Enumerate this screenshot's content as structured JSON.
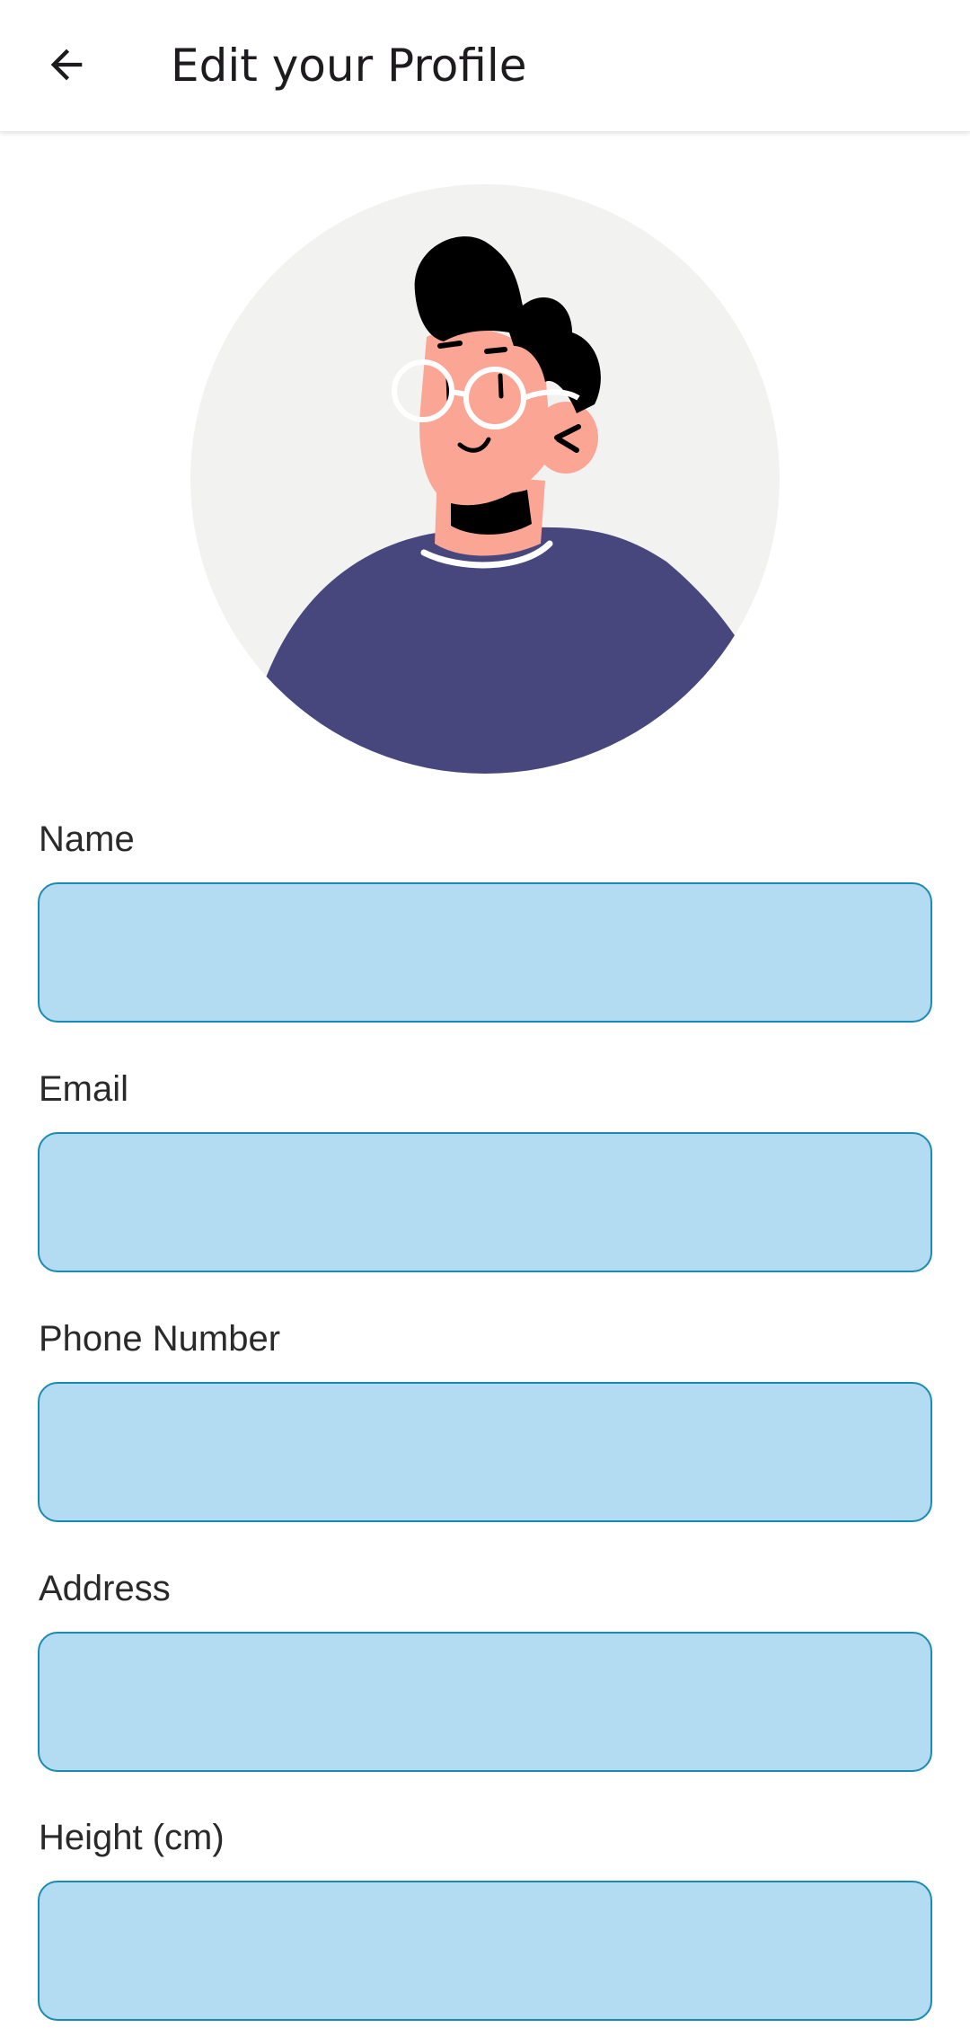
{
  "header": {
    "title": "Edit your Profile",
    "back_icon": "arrow-left-icon"
  },
  "avatar": {
    "icon": "user-avatar-illustration"
  },
  "colors": {
    "field_background": "#b3dbf1",
    "field_border": "#1a8bb3",
    "avatar_background": "#f2f2f1",
    "shirt": "#48477d",
    "skin": "#fba595",
    "hair": "#000000"
  },
  "form": {
    "fields": [
      {
        "label": "Name",
        "value": "",
        "placeholder": ""
      },
      {
        "label": "Email",
        "value": "",
        "placeholder": ""
      },
      {
        "label": "Phone Number",
        "value": "",
        "placeholder": ""
      },
      {
        "label": "Address",
        "value": "",
        "placeholder": ""
      },
      {
        "label": "Height (cm)",
        "value": "",
        "placeholder": ""
      }
    ]
  }
}
